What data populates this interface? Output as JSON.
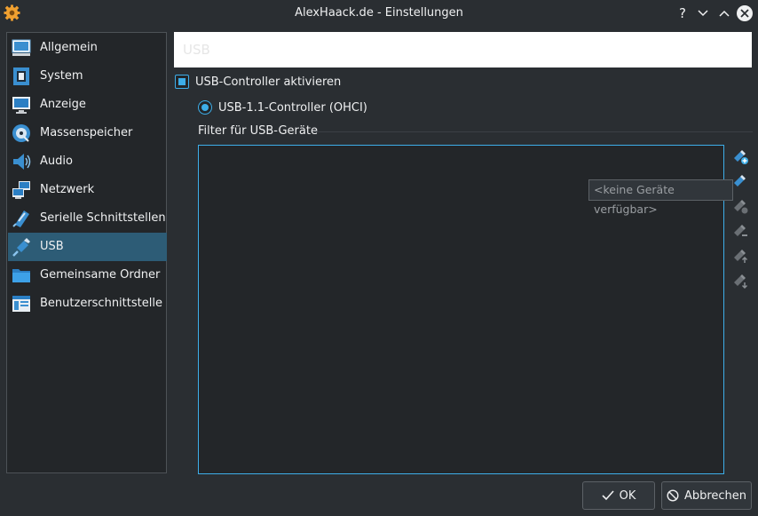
{
  "window": {
    "title": "AlexHaack.de - Einstellungen",
    "help_glyph": "?",
    "minimize_glyph": "⌄",
    "maximize_glyph": "⌃",
    "close_glyph": "✕"
  },
  "sidebar": {
    "items": [
      {
        "label": "Allgemein",
        "icon": "general-icon"
      },
      {
        "label": "System",
        "icon": "chip-icon"
      },
      {
        "label": "Anzeige",
        "icon": "monitor-icon"
      },
      {
        "label": "Massenspeicher",
        "icon": "disk-icon"
      },
      {
        "label": "Audio",
        "icon": "speaker-icon"
      },
      {
        "label": "Netzwerk",
        "icon": "network-icon"
      },
      {
        "label": "Serielle Schnittstellen",
        "icon": "serial-port-icon"
      },
      {
        "label": "USB",
        "icon": "usb-icon",
        "selected": true
      },
      {
        "label": "Gemeinsame Ordner",
        "icon": "folder-icon"
      },
      {
        "label": "Benutzerschnittstelle",
        "icon": "user-interface-icon"
      }
    ]
  },
  "page": {
    "title": "USB",
    "enable_usb_label": "USB-Controller aktivieren",
    "enable_usb_checked": true,
    "controller_label": "USB-1.1-Controller (OHCI)",
    "controller_selected": true,
    "filter_label": "Filter für USB-Geräte",
    "tooltip": "<keine Geräte verfügbar>"
  },
  "buttons": {
    "ok": "OK",
    "cancel": "Abbrechen"
  },
  "colors": {
    "accent": "#3daee9",
    "selection": "#2d5c76",
    "background": "#2a2e32",
    "view_background": "#232629"
  }
}
